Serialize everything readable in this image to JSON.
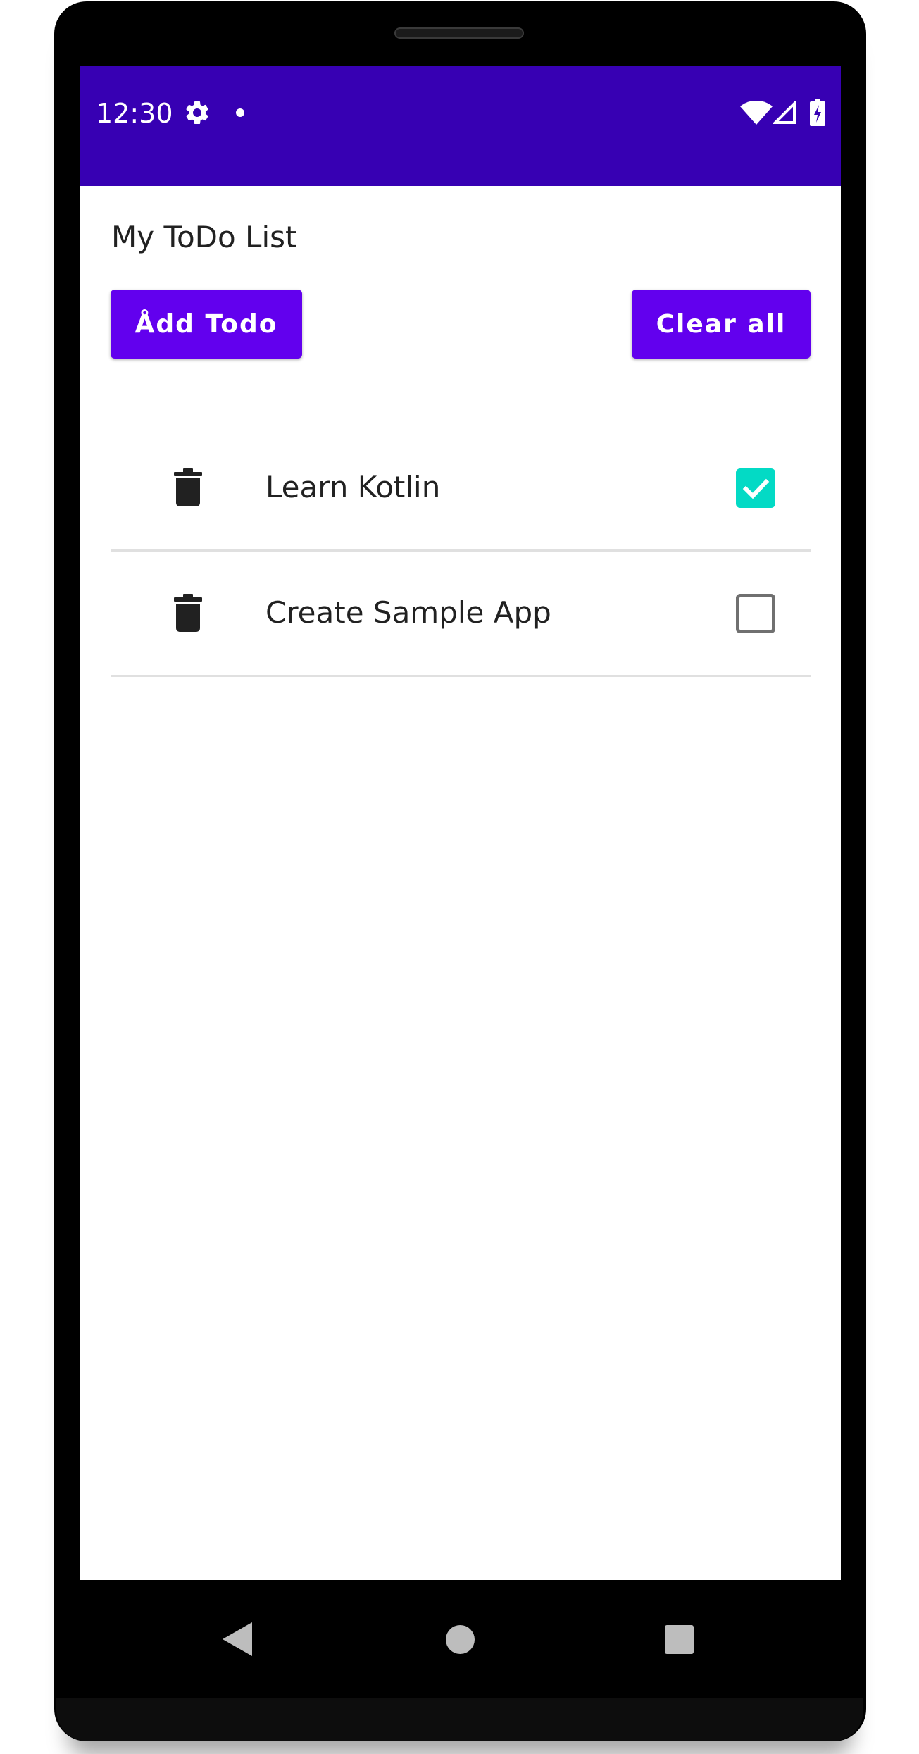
{
  "status_bar": {
    "time": "12:30",
    "icons": [
      "gear-icon",
      "notification-dot-icon",
      "wifi-icon",
      "signal-icon",
      "battery-charging-icon"
    ],
    "background_color": "#3700b3"
  },
  "app": {
    "title": "My ToDo List",
    "add_button_label": "Ådd Todo",
    "clear_button_label": "Clear all",
    "accent_color": "#6200ee",
    "checkbox_checked_color": "#03dac5"
  },
  "todos": [
    {
      "text": "Learn Kotlin",
      "checked": true
    },
    {
      "text": "Create Sample App",
      "checked": false
    }
  ],
  "nav_bar": {
    "icons": [
      "back-icon",
      "home-icon",
      "recents-icon"
    ]
  }
}
